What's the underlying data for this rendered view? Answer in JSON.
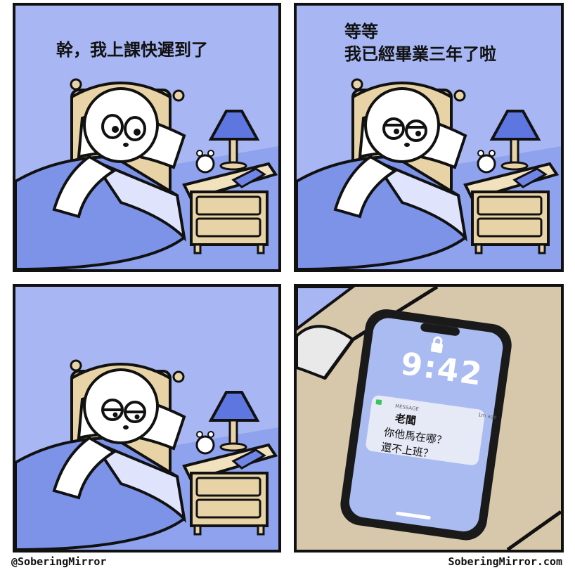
{
  "panel1": {
    "caption": "幹，我上課快遲到了"
  },
  "panel2": {
    "caption_line1": "等等",
    "caption_line2": "我已經畢業三年了啦"
  },
  "panel4": {
    "lock_time": "9:42",
    "notification": {
      "app": "MESSAGE",
      "age": "1m ago",
      "sender": "老闆",
      "line1": "你他馬在哪？",
      "line2": "還不上班？"
    }
  },
  "credits": {
    "left": "@SoberingMirror",
    "right": "SoberingMirror.com"
  },
  "colors": {
    "wall": "#a8b7f3",
    "blanket": "#7c93e8",
    "wood": "#e8d3a6",
    "outline": "#111111"
  }
}
